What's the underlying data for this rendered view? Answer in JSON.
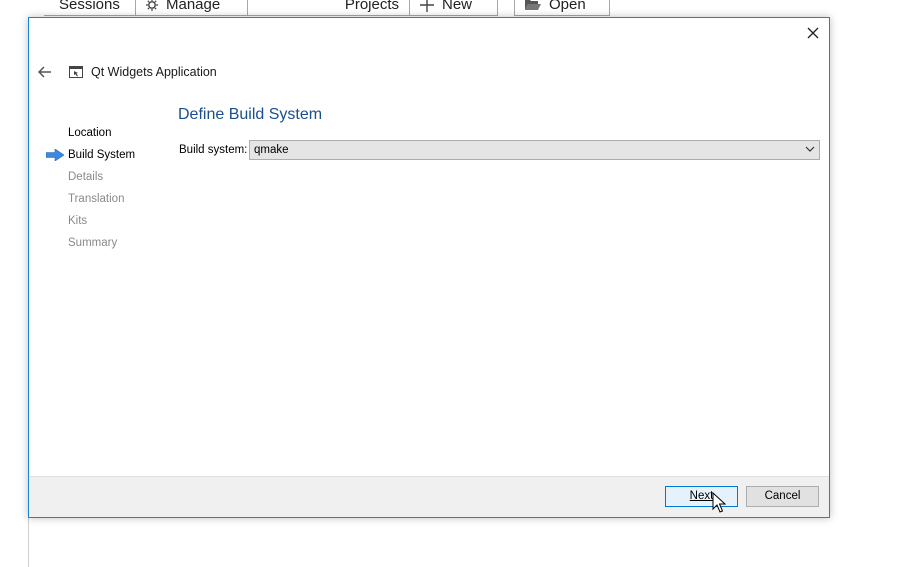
{
  "background": {
    "tabs": [
      {
        "label": "Sessions"
      },
      {
        "label": "Manage",
        "icon": "gear-icon"
      },
      {
        "label": "Projects"
      },
      {
        "label": "New",
        "icon": "plus-icon"
      },
      {
        "label": "Open",
        "icon": "folder-open-icon"
      }
    ]
  },
  "wizard": {
    "title": "Qt Widgets Application",
    "steps": [
      {
        "label": "Location",
        "state": "done"
      },
      {
        "label": "Build System",
        "state": "current"
      },
      {
        "label": "Details",
        "state": "pending"
      },
      {
        "label": "Translation",
        "state": "pending"
      },
      {
        "label": "Kits",
        "state": "pending"
      },
      {
        "label": "Summary",
        "state": "pending"
      }
    ],
    "page_title": "Define Build System",
    "build_system_label": "Build system:",
    "build_system_value": "qmake",
    "buttons": {
      "next": "Next",
      "cancel": "Cancel"
    }
  },
  "colors": {
    "accent": "#0078d7",
    "page_title": "#1b4e8f",
    "step_arrow": "#3c8ae0"
  }
}
